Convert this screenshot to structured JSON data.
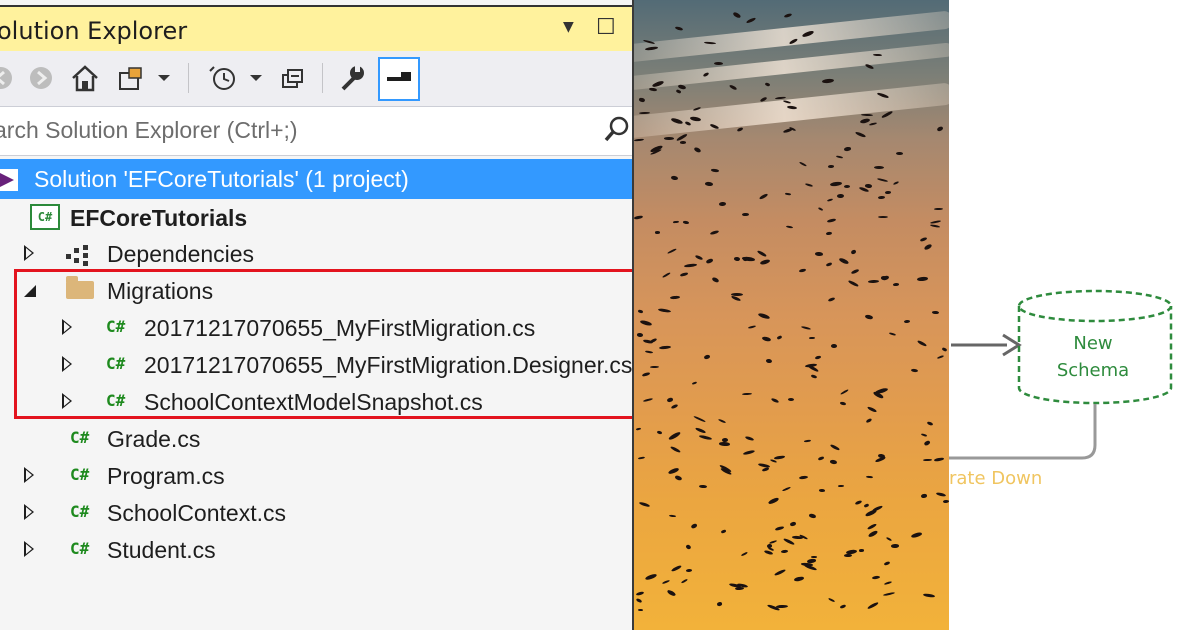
{
  "solution_explorer": {
    "title": "olution Explorer",
    "title_controls": {
      "dropdown_glyph": "▼",
      "maximize_glyph": "☐"
    },
    "toolbar": {
      "icons": [
        "back-icon",
        "forward-icon",
        "home-icon",
        "switch-views-icon",
        "history-icon",
        "collapse-all-icon",
        "properties-wrench-icon",
        "preview-toggle-icon"
      ]
    },
    "search": {
      "placeholder": "arch Solution Explorer (Ctrl+;)"
    },
    "tree": {
      "solution": "Solution 'EFCoreTutorials' (1 project)",
      "project": "EFCoreTutorials",
      "dependencies": "Dependencies",
      "migrations_folder": "Migrations",
      "migration_files": [
        "20171217070655_MyFirstMigration.cs",
        "20171217070655_MyFirstMigration.Designer.cs",
        "SchoolContextModelSnapshot.cs"
      ],
      "files": [
        "Grade.cs",
        "Program.cs",
        "SchoolContext.cs",
        "Student.cs"
      ],
      "cs_glyph": "C#"
    },
    "highlight_color": "#e3141e",
    "selection_color": "#3399ff",
    "title_bar_color": "#fff29d"
  },
  "diagram": {
    "schema_label_line1": "New",
    "schema_label_line2": "Schema",
    "migrate_down_label": "rate Down",
    "schema_color": "#2e8b3d",
    "migrate_down_color": "#f0c560"
  }
}
